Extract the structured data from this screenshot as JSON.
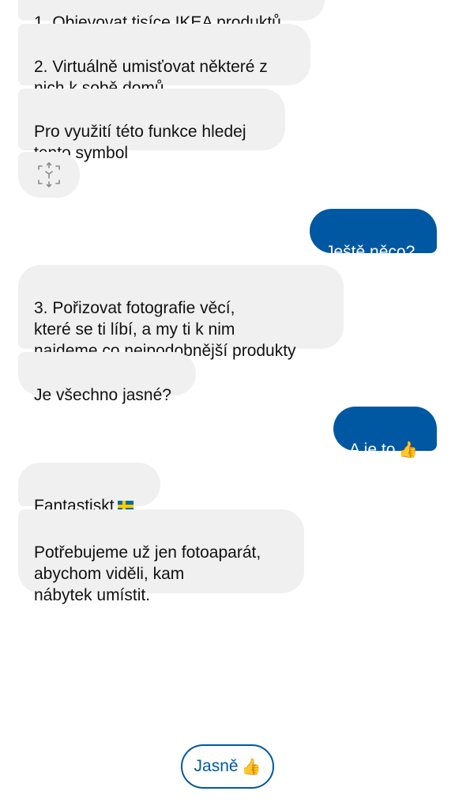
{
  "messages": {
    "m0": "1. Objevovat tisíce IKEA produktů",
    "m1": "2. Virtuálně umisťovat některé z\nnich k sobě domů",
    "m2": "Pro využití této funkce hledej\ntento symbol",
    "u1": "Ještě něco?",
    "m3": "3. Pořizovat fotografie věcí,\nkteré se ti líbí, a my ti k nim\nnajdeme co nejpodobnější produkty",
    "m4": "Je všechno jasné?",
    "u2": "A je to",
    "m5": "Fantastiskt",
    "m6": "Potřebujeme už jen fotoaparát,\nabychom viděli, kam\nnábytek umístit."
  },
  "quick_reply": {
    "label": "Jasně"
  },
  "icons": {
    "ar_symbol": "ar-3d-view-icon",
    "flag": "swedish-flag-icon",
    "thumb": "thumbs-up-icon"
  },
  "colors": {
    "user_bubble": "#0058a3",
    "bot_bubble": "#f0f0f0",
    "accent": "#0058a3"
  }
}
